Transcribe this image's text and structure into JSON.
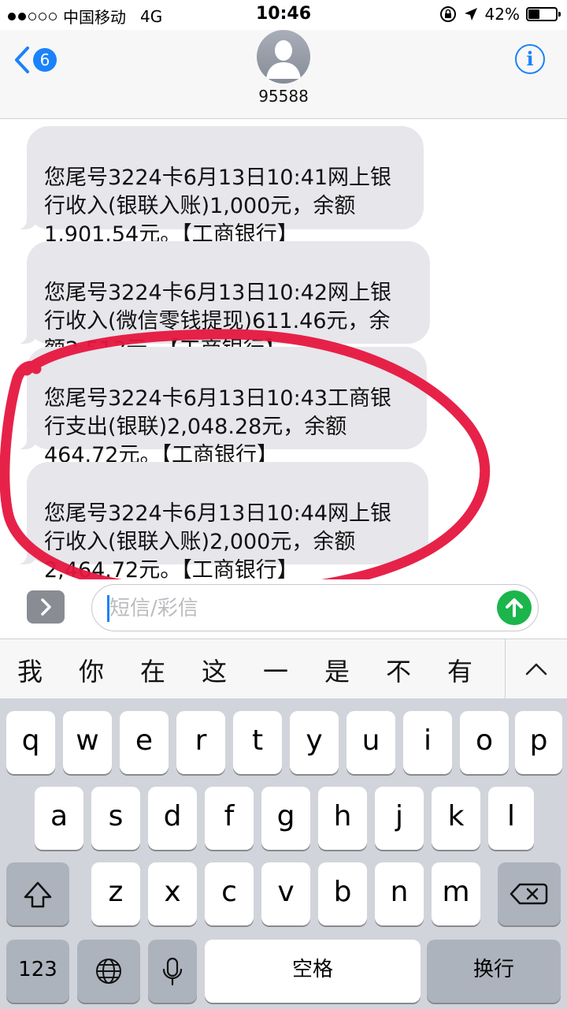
{
  "status_bar": {
    "carrier": "中国移动",
    "network": "4G",
    "time": "10:46",
    "battery": "42%",
    "battery_level": 0.42,
    "signal_bars_filled": 2,
    "signal_bars_total": 5
  },
  "header": {
    "back_count": "6",
    "contact": "95588",
    "info_icon": "i"
  },
  "messages": [
    {
      "text": "您尾号3224卡6月13日10:41网上银\n行收入(银联入账)1,000元，余额\n1,901.54元。【工商银行】"
    },
    {
      "text": "您尾号3224卡6月13日10:42网上银\n行收入(微信零钱提现)611.46元，余\n额2,513元。【工商银行】"
    },
    {
      "text": "您尾号3224卡6月13日10:43工商银\n行支出(银联)2,048.28元，余额\n464.72元。【工商银行】"
    },
    {
      "text": "您尾号3224卡6月13日10:44网上银\n行收入(银联入账)2,000元，余额\n2,464.72元。【工商银行】"
    }
  ],
  "input": {
    "placeholder": "短信/彩信",
    "value": ""
  },
  "candidates": [
    "我",
    "你",
    "在",
    "这",
    "一",
    "是",
    "不",
    "有"
  ],
  "keyboard": {
    "row1": [
      "q",
      "w",
      "e",
      "r",
      "t",
      "y",
      "u",
      "i",
      "o",
      "p"
    ],
    "row2": [
      "a",
      "s",
      "d",
      "f",
      "g",
      "h",
      "j",
      "k",
      "l"
    ],
    "row3": [
      "z",
      "x",
      "c",
      "v",
      "b",
      "n",
      "m"
    ],
    "numbers_key": "123",
    "space_key": "空格",
    "return_key": "换行"
  },
  "colors": {
    "accent": "#1a82fb",
    "send": "#1bb54b",
    "bubble": "#e6e6eb",
    "annotation": "#e6163f"
  }
}
